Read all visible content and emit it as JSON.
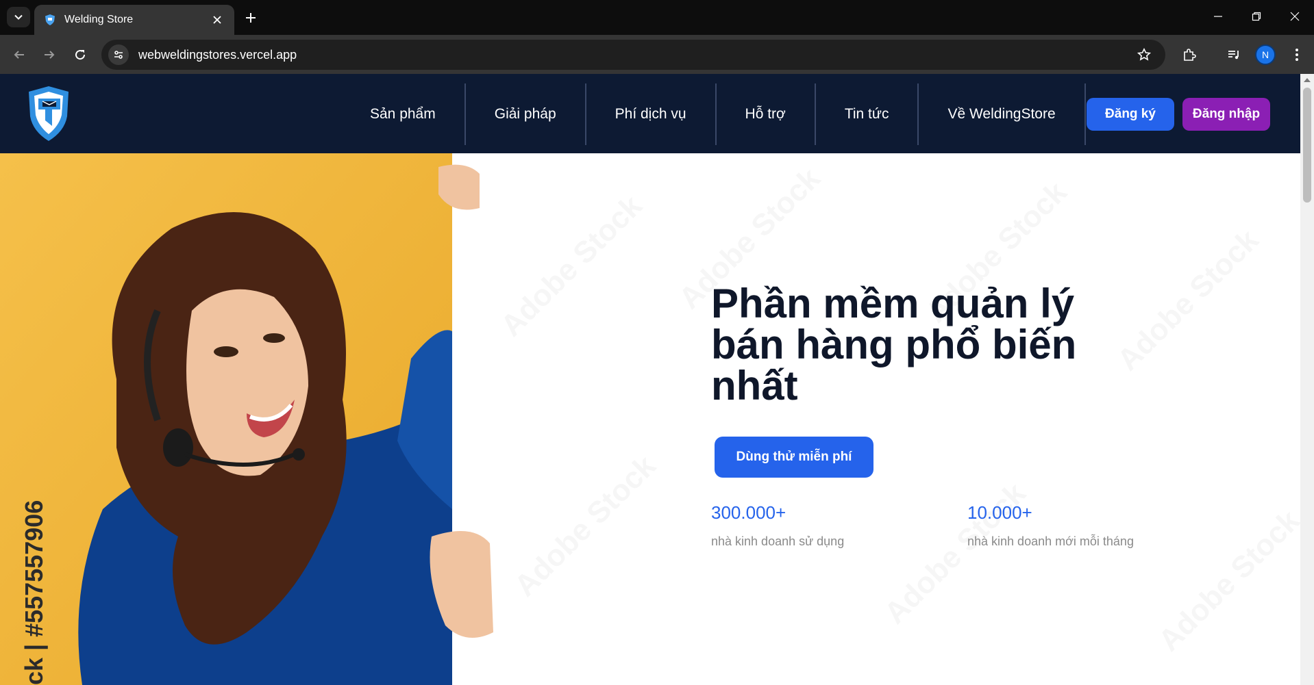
{
  "browser": {
    "tab_title": "Welding Store",
    "url": "webweldingstores.vercel.app",
    "profile_initial": "N"
  },
  "header": {
    "menu": [
      "Sản phẩm",
      "Giải pháp",
      "Phí dịch vụ",
      "Hỗ trợ",
      "Tin tức",
      "Về WeldingStore"
    ],
    "register_label": "Đăng ký",
    "login_label": "Đăng nhập"
  },
  "hero": {
    "title": "Phần mềm quản lý bán hàng phổ biến nhất",
    "cta_label": "Dùng thử miễn phí",
    "stats": [
      {
        "value": "300.000+",
        "label": "nhà kinh doanh sử dụng"
      },
      {
        "value": "10.000+",
        "label": "nhà kinh doanh mới mỗi tháng"
      }
    ],
    "image_watermark": "Adobe Stock",
    "image_caption": "ck | #557557906"
  },
  "colors": {
    "header_bg": "#0d1a33",
    "primary": "#2563eb",
    "login": "#8b1fb4",
    "photo_bg": "#f4b936"
  }
}
